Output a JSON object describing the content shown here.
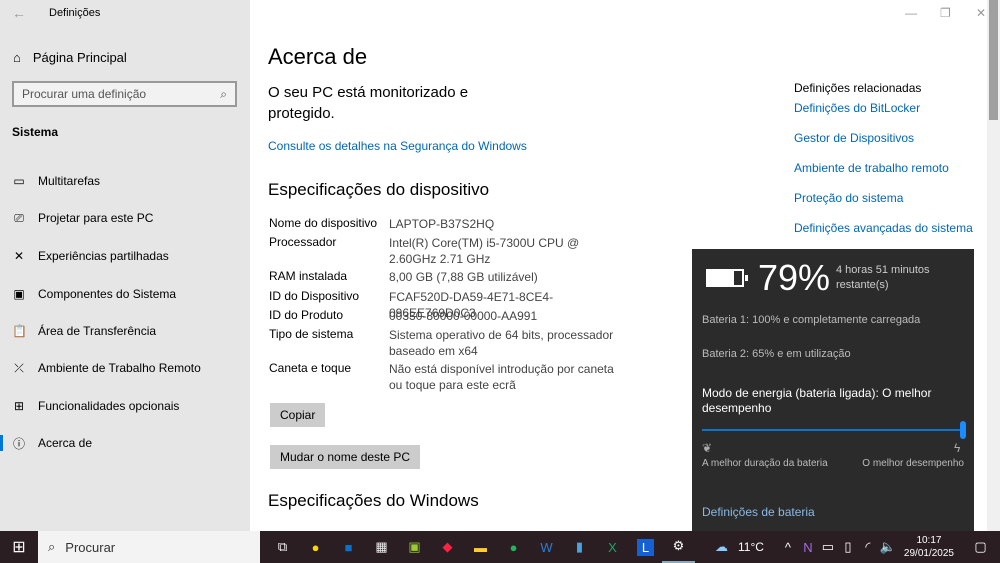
{
  "window": {
    "title": "Definições"
  },
  "sidebar": {
    "home": "Página Principal",
    "search_placeholder": "Procurar uma definição",
    "section": "Sistema",
    "items": [
      {
        "label": "Multitarefas",
        "icon": "▭"
      },
      {
        "label": "Projetar para este PC",
        "icon": "⎚"
      },
      {
        "label": "Experiências partilhadas",
        "icon": "✕"
      },
      {
        "label": "Componentes do Sistema",
        "icon": "▣"
      },
      {
        "label": "Área de Transferência",
        "icon": "📋"
      },
      {
        "label": "Ambiente de Trabalho Remoto",
        "icon": "⤫"
      },
      {
        "label": "Funcionalidades opcionais",
        "icon": "⊞"
      },
      {
        "label": "Acerca de",
        "icon": "ⓘ"
      }
    ]
  },
  "main": {
    "title": "Acerca de",
    "protected": "O seu PC está monitorizado e protegido.",
    "security_link": "Consulte os detalhes na Segurança do Windows",
    "device_specs_title": "Especificações do dispositivo",
    "specs": [
      {
        "k": "Nome do dispositivo",
        "v": "LAPTOP-B37S2HQ"
      },
      {
        "k": "Processador",
        "v": "Intel(R) Core(TM) i5-7300U CPU @ 2.60GHz 2.71 GHz"
      },
      {
        "k": "RAM instalada",
        "v": "8,00 GB (7,88 GB utilizável)"
      },
      {
        "k": "ID do Dispositivo",
        "v": "FCAF520D-DA59-4E71-8CE4-096EE769D0C3"
      },
      {
        "k": "ID do Produto",
        "v": "00330-80000-00000-AA991"
      },
      {
        "k": "Tipo de sistema",
        "v": "Sistema operativo de 64 bits, processador baseado em x64"
      },
      {
        "k": "Caneta e toque",
        "v": "Não está disponível introdução por caneta ou toque para este ecrã"
      }
    ],
    "copy_button": "Copiar",
    "rename_button": "Mudar o nome deste PC",
    "windows_specs_title": "Especificações do Windows"
  },
  "related": {
    "title": "Definições relacionadas",
    "links": [
      "Definições do BitLocker",
      "Gestor de Dispositivos",
      "Ambiente de trabalho remoto",
      "Proteção do sistema",
      "Definições avançadas do sistema"
    ]
  },
  "battery": {
    "percent": "79%",
    "remaining": "4 horas 51 minutos restante(s)",
    "battery1": "Bateria 1: 100% e completamente carregada",
    "battery2": "Bateria 2: 65% e em utilização",
    "mode": "Modo de energia (bateria ligada): O melhor desempenho",
    "slider_value": 1.0,
    "left_label": "A melhor duração da bateria",
    "right_label": "O melhor desempenho",
    "settings_link": "Definições de bateria"
  },
  "taskbar": {
    "search": "Procurar",
    "temp": "11°C",
    "time": "10:17",
    "date": "29/01/2025"
  }
}
